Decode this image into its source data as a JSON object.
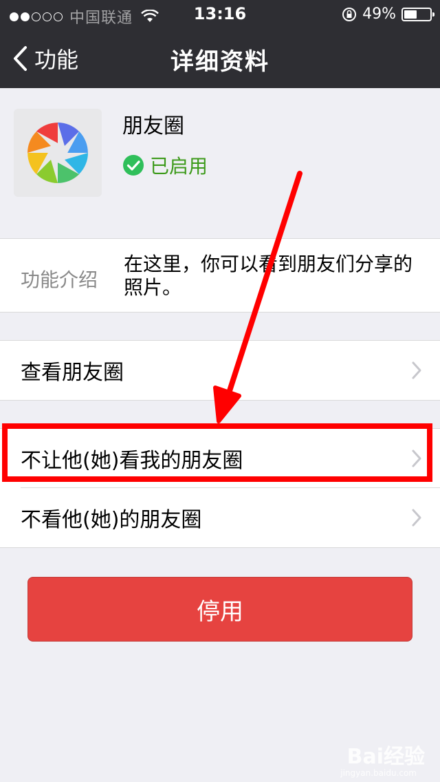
{
  "status_bar": {
    "carrier": "中国联通",
    "time": "13:16",
    "battery_percent": "49%",
    "battery_level": 0.49
  },
  "nav": {
    "back_label": "功能",
    "title": "详细资料"
  },
  "app": {
    "name": "朋友圈",
    "status": "已启用",
    "status_color": "#3c9a1a"
  },
  "intro": {
    "label": "功能介绍",
    "text": "在这里，你可以看到朋友们分享的照片。"
  },
  "rows": {
    "view_moments": "查看朋友圈",
    "hide_my_moments": "不让他(她)看我的朋友圈",
    "hide_their_moments": "不看他(她)的朋友圈"
  },
  "disable_button": {
    "label": "停用",
    "color": "#e64340"
  },
  "annotation": {
    "highlight_color": "#ff0000"
  },
  "watermark": {
    "brand": "Bai经验",
    "url": "jingyan.baidu.com"
  }
}
